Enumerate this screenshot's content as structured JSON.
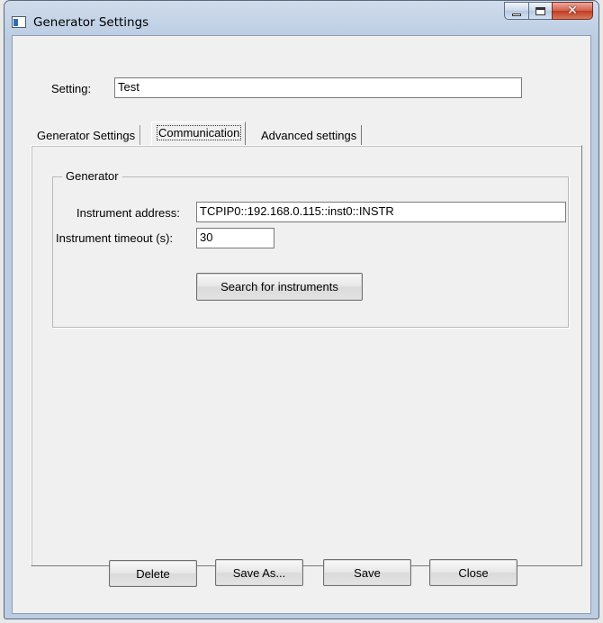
{
  "window": {
    "title": "Generator Settings"
  },
  "setting": {
    "label": "Setting:",
    "value": "Test"
  },
  "tabs": [
    {
      "label": "Generator Settings"
    },
    {
      "label": "Communication"
    },
    {
      "label": "Advanced settings"
    }
  ],
  "generator_group": {
    "title": "Generator",
    "address_label": "Instrument address:",
    "address_value": "TCPIP0::192.168.0.115::inst0::INSTR",
    "timeout_label": "Instrument timeout (s):",
    "timeout_value": "30",
    "search_button": "Search for instruments"
  },
  "footer": {
    "delete": "Delete",
    "save_as": "Save As...",
    "save": "Save",
    "close": "Close"
  },
  "icons": {
    "app": "window-app-icon",
    "minimize": "minimize-icon",
    "maximize": "maximize-icon",
    "close": "close-icon"
  },
  "colors": {
    "title_gradient": "#bccde3",
    "close_button": "#c03c22",
    "client_bg": "#f0f0f0"
  }
}
